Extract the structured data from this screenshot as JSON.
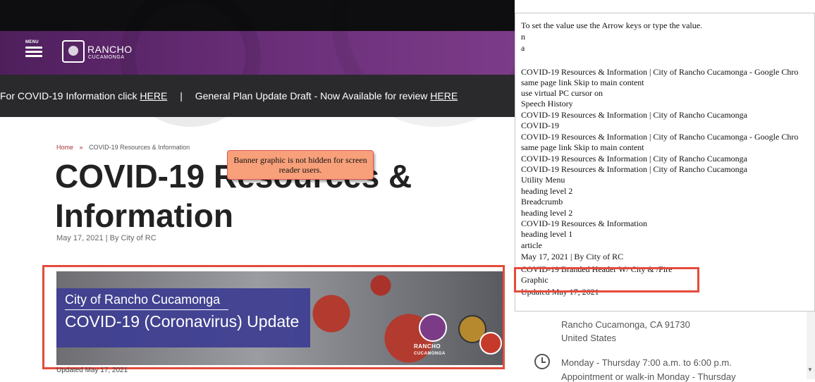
{
  "site": {
    "menu_label": "MENU",
    "logo_word1": "RANCHO",
    "logo_word2": "CUCAMONGA",
    "alert": {
      "part1": "For COVID-19 Information click ",
      "link1": "HERE",
      "sep": "|",
      "part2": "General Plan Update Draft - Now Available for review ",
      "link2": "HERE"
    },
    "breadcrumb": {
      "home": "Home",
      "sep": "»",
      "current": "COVID-19 Resources & Information"
    },
    "title_line1": "COVID-19 Resources &",
    "title_line2": "Information",
    "meta": "May 17, 2021 | By City of RC",
    "callout": "Banner graphic is not hidden for screen reader users.",
    "banner": {
      "line1": "City of Rancho Cucamonga",
      "line2": "COVID-19 (Coronavirus) Update",
      "logo_text": "RANCHO",
      "logo_sub": "CUCAMONGA"
    },
    "updated": "Updated May 17, 2021"
  },
  "speech_history": {
    "lines": [
      "To set the value use the Arrow keys or type the value.",
      "n",
      "a",
      "",
      "COVID-19 Resources & Information | City of Rancho Cucamonga - Google Chro",
      "same page link Skip to main content",
      "use virtual PC cursor on",
      "Speech History",
      "COVID-19 Resources & Information | City of Rancho Cucamonga",
      "COVID-19",
      "COVID-19 Resources & Information | City of Rancho Cucamonga - Google Chro",
      "same page link Skip to main content",
      "COVID-19 Resources & Information | City of Rancho Cucamonga",
      "COVID-19 Resources & Information | City of Rancho Cucamonga",
      "Utility Menu",
      "heading level 2",
      "Breadcrumb",
      "heading level 2",
      "COVID-19 Resources & Information",
      "heading level 1",
      "article",
      "May 17, 2021 | By City of RC",
      "COVID-19 Branded Header W/ City & /Fire",
      "Graphic",
      "Updated May 17, 2021"
    ]
  },
  "right_page": {
    "address": "Rancho Cucamonga, CA 91730",
    "country": "United States",
    "hours": "Monday - Thursday 7:00 a.m. to 6:00 p.m.",
    "appointment": "Appointment or walk-in Monday - Thursday"
  }
}
